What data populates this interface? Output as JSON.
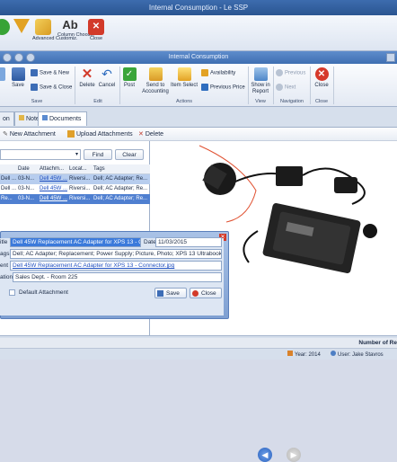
{
  "outer_window": {
    "title": "Internal Consumption - Le SSP"
  },
  "outer_toolbar": [
    {
      "label": "",
      "icon": "green-arrow-icon",
      "color": "#37a336"
    },
    {
      "label": "Filter",
      "icon": "filter-icon",
      "color": "#e2a223"
    },
    {
      "label": "Advanced Customiz.",
      "icon": "customize-icon",
      "color": "#e6b13c"
    },
    {
      "label": "Column Chooser",
      "icon": "font-icon",
      "color": "#4a4a4a"
    },
    {
      "label": "Close",
      "icon": "close-icon",
      "color": "#d23a2a"
    }
  ],
  "inner_window": {
    "title": "Internal Consumption"
  },
  "ribbon": {
    "save_group": {
      "save": "Save",
      "save_new": "Save & New",
      "save_close": "Save & Close",
      "label": "Save"
    },
    "edit_group": {
      "delete": "Delete",
      "cancel": "Cancel",
      "label": "Edit"
    },
    "actions_group": {
      "post": "Post",
      "send_accounting": "Send to Accounting",
      "item_select": "Item Select",
      "availability": "Availability",
      "previous_price": "Previous Price",
      "label": "Actions"
    },
    "view_group": {
      "show_report": "Show in Report",
      "label": "View"
    },
    "navigation_group": {
      "previous": "Previous",
      "next": "Next",
      "label": "Navigation"
    },
    "close_group": {
      "close": "Close",
      "label": "Close"
    }
  },
  "tabs": [
    {
      "label": "on",
      "active": false
    },
    {
      "label": "Notes",
      "active": false
    },
    {
      "label": "Documents",
      "active": true
    }
  ],
  "doc_toolbar": {
    "new_attachment": "New Attachment",
    "upload_attachments": "Upload Attachments",
    "delete": "Delete"
  },
  "search": {
    "find": "Find",
    "clear": "Clear"
  },
  "grid": {
    "columns": [
      "",
      "Date",
      "Attachm...",
      "Locat...",
      "Tags"
    ],
    "rows": [
      {
        "c0": "Dell ...",
        "date": "03-N...",
        "attachment": "Dell 45W ...",
        "location": "Riversi...",
        "tags": "Dell; AC Adapter; Re...",
        "state": "sel"
      },
      {
        "c0": "Dell ...",
        "date": "03-N...",
        "attachment": "Dell 45W ...",
        "location": "Riversi...",
        "tags": "Dell; AC Adapter; Re...",
        "state": ""
      },
      {
        "c0": "Re...",
        "date": "03-N...",
        "attachment": "Dell 45W ...",
        "location": "Riversi...",
        "tags": "Dell; AC Adapter; Re...",
        "state": "hi"
      }
    ]
  },
  "dialog": {
    "title_label": "itle",
    "title_value": "Dell 45W Replacement AC Adapter for XPS 13 - Conne",
    "date_label": "Date",
    "date_value": "11/03/2015",
    "tags_label": "ags",
    "tags_value": "Dell; AC Adapter; Replacement; Power Supply; Picture, Photo; XPS 13 Ultrabook; Conne",
    "attachment_label": "ent",
    "attachment_value": "Dell 45W Replacement AC Adapter for XPS 13 - Connector.jpg",
    "location_label": "ation",
    "location_value": "Sales Dept. - Room 225",
    "default_attachment": "Default Attachment",
    "save": "Save",
    "close": "Close"
  },
  "status": {
    "number_label": "Number of Re",
    "year": "Year: 2014",
    "user": "User: Jake Stavros"
  }
}
